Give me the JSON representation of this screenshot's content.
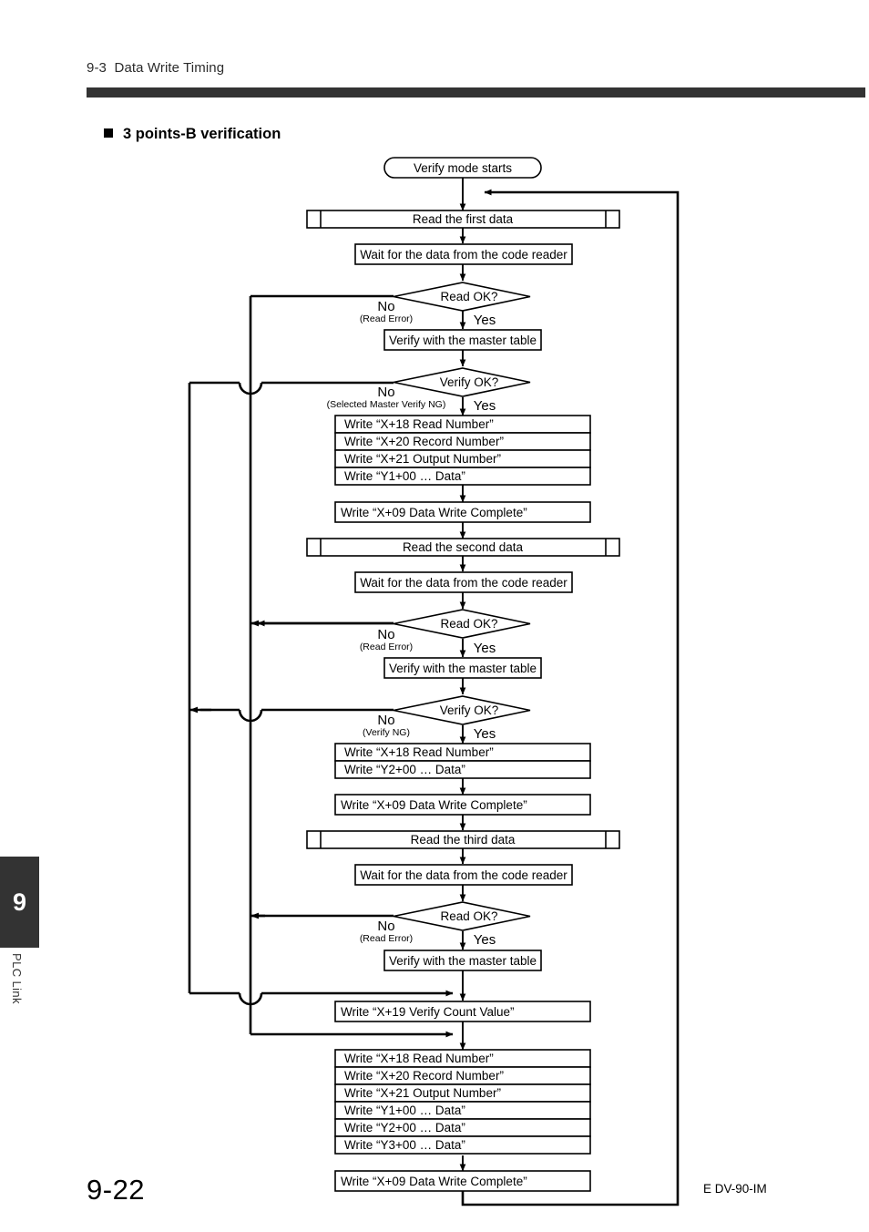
{
  "header": {
    "section": "9-3  Data Write Timing",
    "topic": "3 points-B verification"
  },
  "sidebar": {
    "chapter_number": "9",
    "chapter_label": "PLC Link"
  },
  "footer": {
    "page_number": "9-22",
    "doc_code": "E DV-90-IM"
  },
  "flowchart": {
    "terminal": "Verify mode starts",
    "branch_yes": "Yes",
    "branch_no": "No",
    "decision_read": "Read OK?",
    "decision_verify": "Verify OK?",
    "sub_read_error": "(Read Error)",
    "sub_selected_master_verify_ng": "(Selected Master Verify NG)",
    "sub_verify_ng": "(Verify NG)",
    "read_first": "Read the first data",
    "read_second": "Read the second data",
    "read_third": "Read the third data",
    "wait_reader": "Wait for the data from the code reader",
    "verify_master": "Verify with the master table",
    "write_complete": "Write “X+09 Data Write Complete”",
    "write_verify_count": "Write “X+19 Verify Count Value”",
    "write_read_number": "Write “X+18 Read Number”",
    "write_record_number": "Write “X+20 Record Number”",
    "write_output_number": "Write “X+21 Output Number”",
    "write_y1_data": "Write “Y1+00 … Data”",
    "write_y2_data": "Write “Y2+00 … Data”",
    "write_y3_data": "Write “Y3+00 … Data”"
  },
  "colors": {
    "rule": "#333333",
    "ink": "#000000",
    "paper": "#ffffff"
  }
}
